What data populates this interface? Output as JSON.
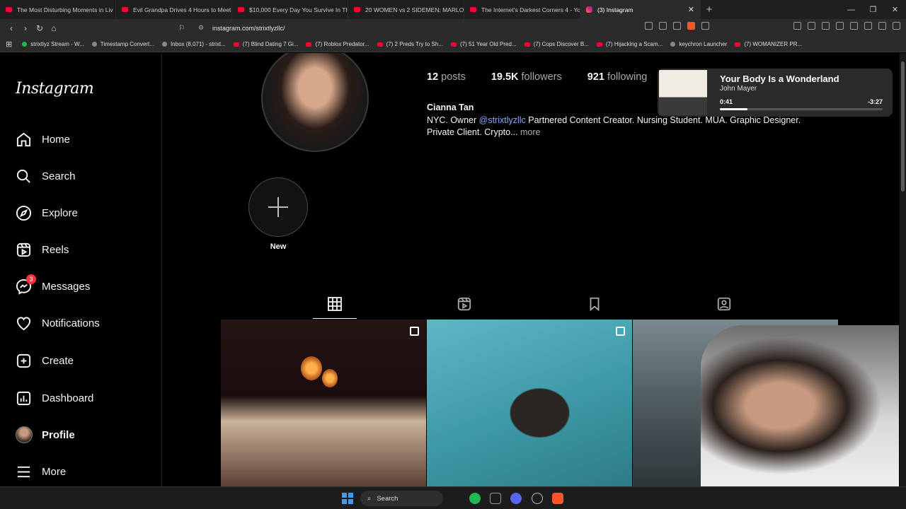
{
  "browser": {
    "tabs": [
      {
        "title": "The Most Disturbing Moments in Liv"
      },
      {
        "title": "Evil Grandpa Drives 4 Hours to Meet"
      },
      {
        "title": "$10,000 Every Day You Survive In The"
      },
      {
        "title": "20 WOMEN vs 2 SIDEMEN: MARLON"
      },
      {
        "title": "The Internet's Darkest Corners 4 - Yo"
      },
      {
        "title": "(3) Instagram",
        "active": true
      }
    ],
    "url": "instagram.com/strixtlyzllc/",
    "bookmarks": [
      "strixtlyz Stream - W...",
      "Timestamp Convert...",
      "Inbox (8,071) - strixt...",
      "(7) Blind Dating 7 Gi...",
      "(7) Roblox Predator...",
      "(7) 2 Preds Try to Sh...",
      "(7) 51 Year Old Pred...",
      "(7) Cops Discover B...",
      "(7) Hijacking a Scam...",
      "keychron Launcher",
      "(7) WOMANIZER PR..."
    ]
  },
  "sidebar": {
    "logo": "Instagram",
    "items": [
      {
        "label": "Home",
        "icon": "home-icon"
      },
      {
        "label": "Search",
        "icon": "search-icon"
      },
      {
        "label": "Explore",
        "icon": "compass-icon"
      },
      {
        "label": "Reels",
        "icon": "reels-icon"
      },
      {
        "label": "Messages",
        "icon": "messenger-icon",
        "badge": "3"
      },
      {
        "label": "Notifications",
        "icon": "heart-icon"
      },
      {
        "label": "Create",
        "icon": "plus-square-icon"
      },
      {
        "label": "Dashboard",
        "icon": "dashboard-icon"
      },
      {
        "label": "Profile",
        "icon": "avatar"
      },
      {
        "label": "More",
        "icon": "menu-icon"
      }
    ]
  },
  "profile": {
    "posts_count": "12",
    "posts_label": "posts",
    "followers_count": "19.5K",
    "followers_label": "followers",
    "following_count": "921",
    "following_label": "following",
    "full_name": "Cianna Tan",
    "bio_line1_prefix": "NYC. Owner ",
    "bio_mention": "@strixtlyzllc",
    "bio_line1_suffix": " Partnered Content Creator. Nursing Student. MUA. Graphic Designer.",
    "bio_line2": "Private Client. Crypto...",
    "bio_more": "more",
    "highlight_new_label": "New"
  },
  "player": {
    "title": "Your Body Is a Wonderland",
    "artist": "John Mayer",
    "elapsed": "0:41",
    "remaining": "-3:27",
    "progress": 0.17
  },
  "taskbar": {
    "search_label": "Search"
  },
  "colors": {
    "accent_link": "#8aa6ff",
    "badge": "#ff3040"
  }
}
